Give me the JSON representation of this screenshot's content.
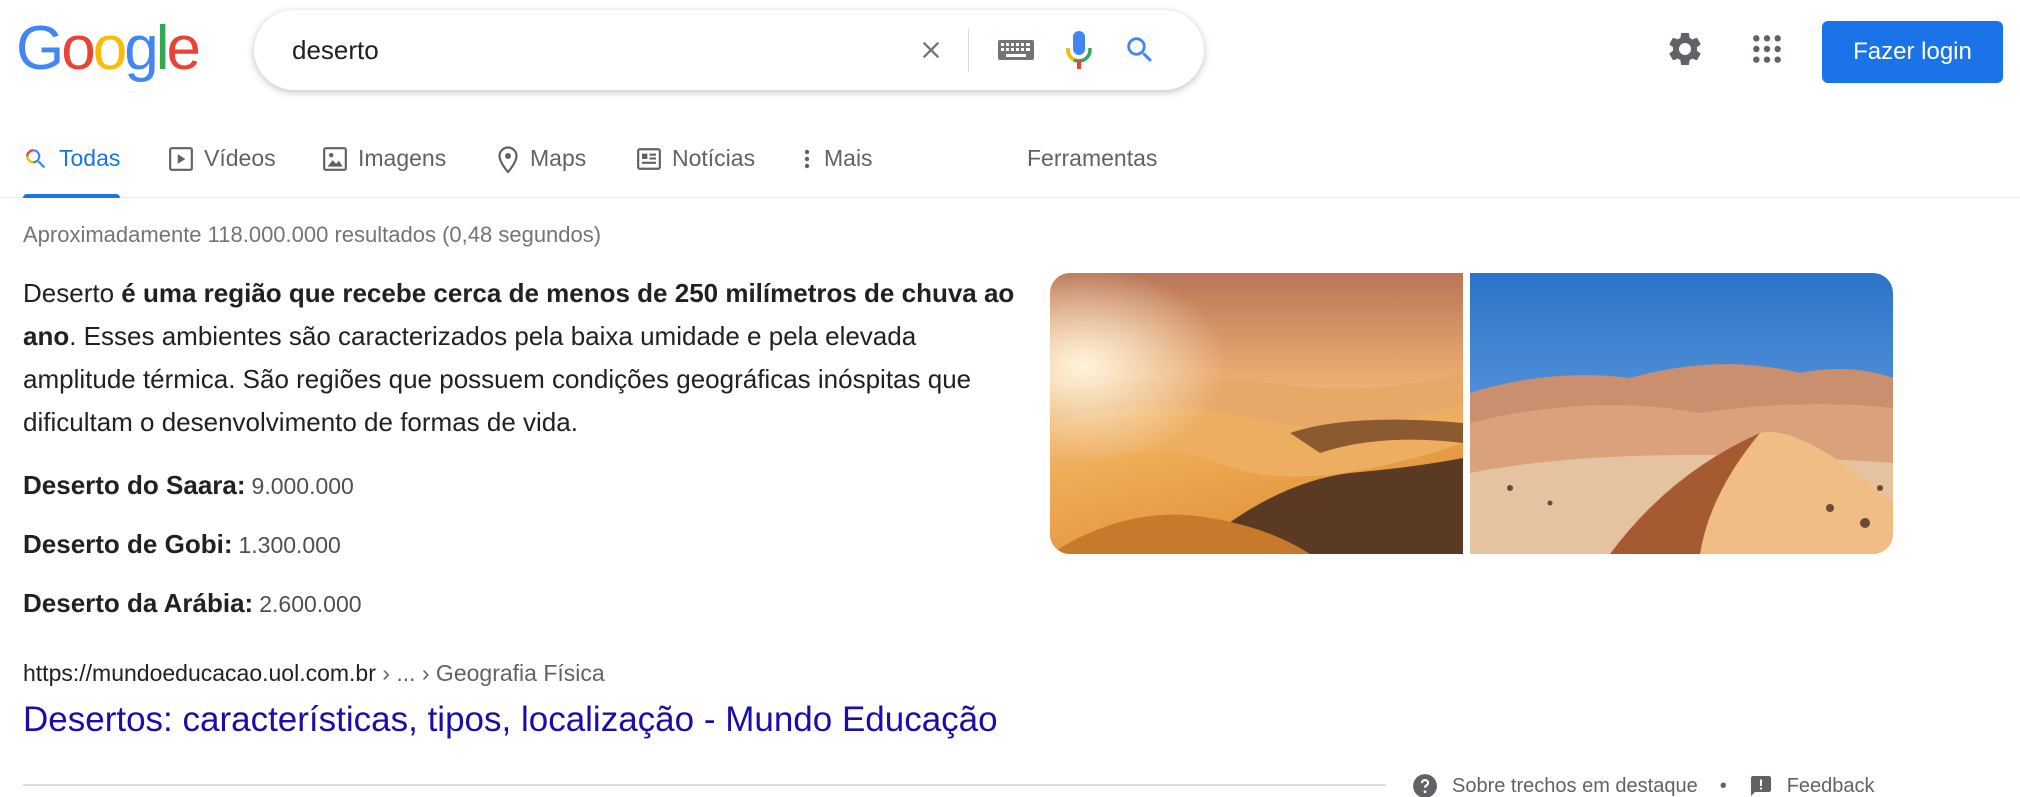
{
  "header": {
    "logo_letters": [
      "G",
      "o",
      "o",
      "g",
      "l",
      "e"
    ],
    "logo_colors": [
      "#4285F4",
      "#EA4335",
      "#FBBC05",
      "#4285F4",
      "#34A853",
      "#EA4335"
    ],
    "search_value": "deserto",
    "icons": {
      "clear": "close-icon",
      "keyboard": "keyboard-icon",
      "mic": "mic-icon",
      "search": "search-icon",
      "settings": "gear-icon",
      "apps": "apps-grid-icon"
    },
    "login_label": "Fazer login",
    "login_color": "#1a73e8"
  },
  "tabs": [
    {
      "label": "Todas",
      "icon": "search-icon",
      "active": true
    },
    {
      "label": "Vídeos",
      "icon": "play-icon",
      "active": false
    },
    {
      "label": "Imagens",
      "icon": "image-icon",
      "active": false
    },
    {
      "label": "Maps",
      "icon": "map-pin-icon",
      "active": false
    },
    {
      "label": "Notícias",
      "icon": "news-icon",
      "active": false
    },
    {
      "label": "Mais",
      "icon": "more-vert-icon",
      "active": false
    },
    {
      "label": "Ferramentas",
      "icon": "",
      "active": false
    }
  ],
  "result_stats": "Aproximadamente 118.000.000 resultados (0,48 segundos)",
  "snippet": {
    "p1": "Deserto ",
    "b1": "é uma região que recebe cerca de menos de 250 milímetros de chuva ao ano",
    "p2": ". Esses ambientes são caracterizados pela baixa umidade e pela elevada amplitude térmica. São regiões que possuem condições geográficas inóspitas que dificultam o desenvolvimento de formas de vida."
  },
  "facts": [
    {
      "label": "Deserto do Saara:",
      "value": "9.000.000"
    },
    {
      "label": "Deserto de Gobi:",
      "value": "1.300.000"
    },
    {
      "label": "Deserto da Arábia:",
      "value": "2.600.000"
    }
  ],
  "result": {
    "domain": "https://mundoeducacao.uol.com.br",
    "crumbs": " › ... › Geografia Física",
    "title": "Desertos: características, tipos, localização - Mundo Educação",
    "link_color": "#1a0dab"
  },
  "footer": {
    "about_label": "Sobre trechos em destaque",
    "separator": "•",
    "feedback_label": "Feedback"
  }
}
